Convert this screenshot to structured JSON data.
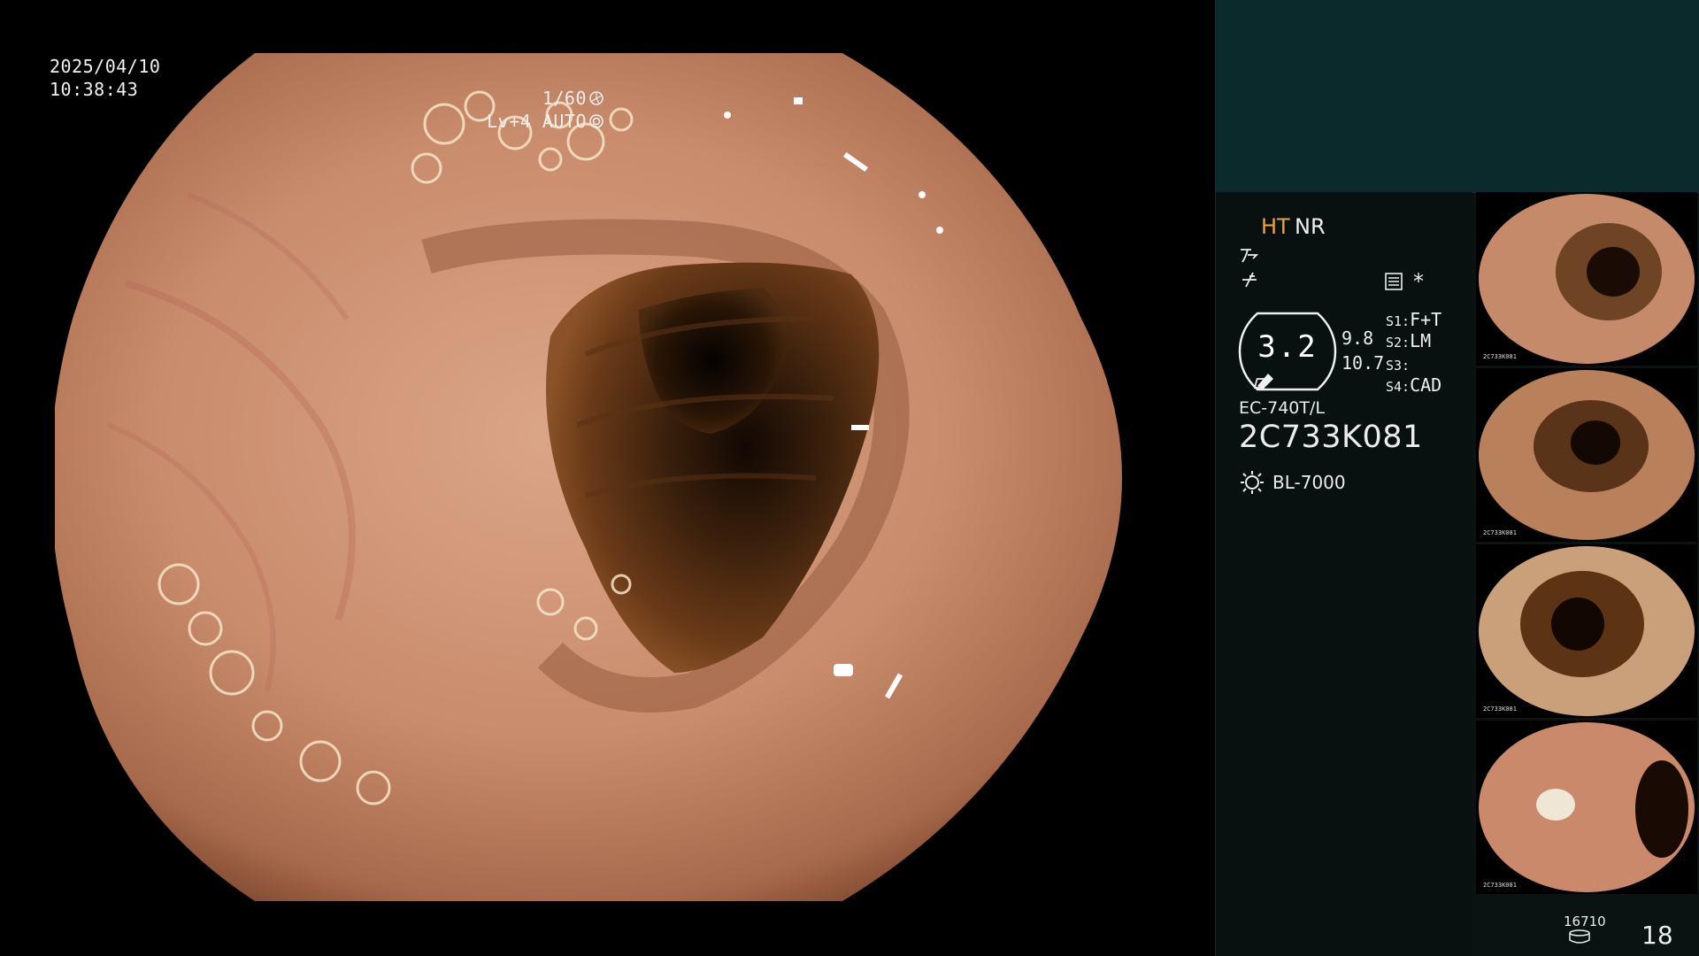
{
  "overlay": {
    "date": "2025/04/10",
    "time": "10:38:43",
    "shutter": "1/60",
    "iris": "Lv+4 AUTO"
  },
  "panel": {
    "mode_ht": "HT",
    "mode_nr": "NR",
    "asterisk": "*",
    "zoom_value": "3.2",
    "zoom_a": "9.8",
    "zoom_b": "10.7",
    "switches": [
      {
        "key": "S1:",
        "value": "F+T"
      },
      {
        "key": "S2:",
        "value": "LM"
      },
      {
        "key": "S3:",
        "value": ""
      },
      {
        "key": "S4:",
        "value": "CAD"
      }
    ],
    "scope_model": "EC-740T/L",
    "scope_serial": "2C733K081",
    "light_source": "BL-7000",
    "storage_count": "16710",
    "image_count": "18"
  },
  "thumbnails": [
    {
      "caption": "2C733K081"
    },
    {
      "caption": "2C733K081"
    },
    {
      "caption": "2C733K081"
    },
    {
      "caption": "2C733K081"
    }
  ],
  "colors": {
    "header_teal": "#0b2a2c",
    "panel_dark": "#0a1212",
    "ht_orange": "#f2a33a",
    "mucosa": "#c98c6c",
    "lumen": "#3a200c"
  },
  "icons": [
    "shutter-icon",
    "iris-icon",
    "enhance-icon",
    "menu-icon",
    "oval-zoom-icon",
    "light-source-icon",
    "storage-disk-icon"
  ]
}
